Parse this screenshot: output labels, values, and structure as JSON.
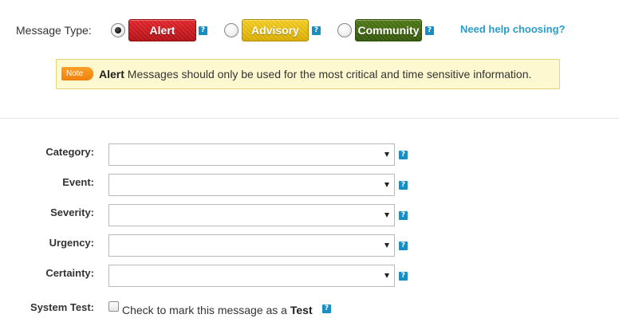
{
  "message_type": {
    "label": "Message Type:",
    "options": [
      {
        "label": "Alert",
        "selected": true,
        "color": "#c8181d"
      },
      {
        "label": "Advisory",
        "selected": false,
        "color": "#e8be0c"
      },
      {
        "label": "Community",
        "selected": false,
        "color": "#426a10"
      }
    ],
    "need_help_link": "Need help choosing?",
    "help_glyph": "?"
  },
  "note": {
    "badge": "Note",
    "strong": "Alert",
    "text": " Messages should only be used for the most critical and time sensitive information."
  },
  "form": {
    "fields": [
      {
        "label": "Category:",
        "value": ""
      },
      {
        "label": "Event:",
        "value": ""
      },
      {
        "label": "Severity:",
        "value": ""
      },
      {
        "label": "Urgency:",
        "value": ""
      },
      {
        "label": "Certainty:",
        "value": ""
      }
    ],
    "system_test": {
      "label": "System Test:",
      "checkbox_text": "Check to mark this message as a ",
      "checkbox_strong": "Test",
      "checked": false
    }
  },
  "colors": {
    "link": "#2c9bc8",
    "help_icon": "#1b8ec1",
    "note_badge": "#f39420",
    "note_bg": "#fdf8cf"
  }
}
